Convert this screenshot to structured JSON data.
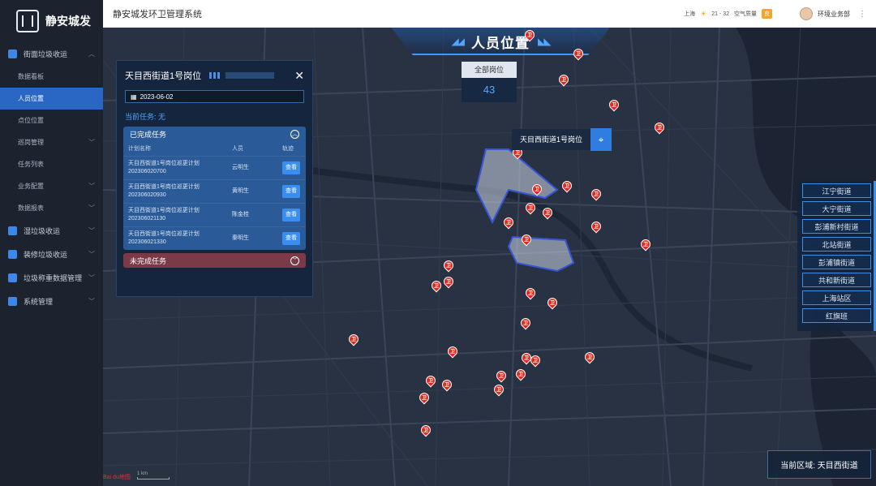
{
  "brand": {
    "name": "静安城发"
  },
  "sidebar": {
    "groups": [
      {
        "label": "街面垃圾收运",
        "icon": "home-icon"
      },
      {
        "label": "湿垃圾收运",
        "icon": "bin-icon"
      },
      {
        "label": "装修垃圾收运",
        "icon": "hammer-icon"
      },
      {
        "label": "垃圾称重数据管理",
        "icon": "scale-icon"
      },
      {
        "label": "系统管理",
        "icon": "settings-icon"
      }
    ],
    "subs": [
      {
        "label": "数据看板"
      },
      {
        "label": "人员位置"
      },
      {
        "label": "点位位置"
      },
      {
        "label": "巡岗管理"
      },
      {
        "label": "任务列表"
      },
      {
        "label": "业务配置"
      },
      {
        "label": "数据报表"
      }
    ]
  },
  "topbar": {
    "title": "静安城发环卫管理系统",
    "city": "上海",
    "temp": "21 - 32",
    "aqi_label": "空气质量",
    "aqi_value": "良",
    "user": "环境业务部"
  },
  "map": {
    "title": "人员位置",
    "total_label": "全部岗位",
    "total_value": "43",
    "post_label": "天目西街道1号岗位",
    "current_area_label": "当前区域:",
    "current_area": "天目西街道",
    "baidu": "Bai du地图",
    "scale": "1 km"
  },
  "popup": {
    "title": "天目西街道1号岗位",
    "date": "2023-06-02",
    "current_task_label": "当前任务:",
    "current_task": "无",
    "completed_label": "已完成任务",
    "incomplete_label": "未完成任务",
    "columns": [
      "计划名称",
      "人员",
      "轨迹"
    ],
    "rows": [
      {
        "plan": "天目西街道1号岗位巡更计划",
        "code": "202306020700",
        "person": "云明生",
        "action": "查看"
      },
      {
        "plan": "天目西街道1号岗位巡更计划",
        "code": "202306020930",
        "person": "黄明生",
        "action": "查看"
      },
      {
        "plan": "天目西街道1号岗位巡更计划",
        "code": "202306021130",
        "person": "陈金桂",
        "action": "查看"
      },
      {
        "plan": "天目西街道1号岗位巡更计划",
        "code": "202306021330",
        "person": "秦明生",
        "action": "查看"
      }
    ]
  },
  "streets": [
    "江宁街道",
    "大宁街道",
    "彭浦新村街道",
    "北站街道",
    "彭浦镇街道",
    "共和新街道",
    "上海站区",
    "红旗班"
  ],
  "pin_glyph": "卫"
}
